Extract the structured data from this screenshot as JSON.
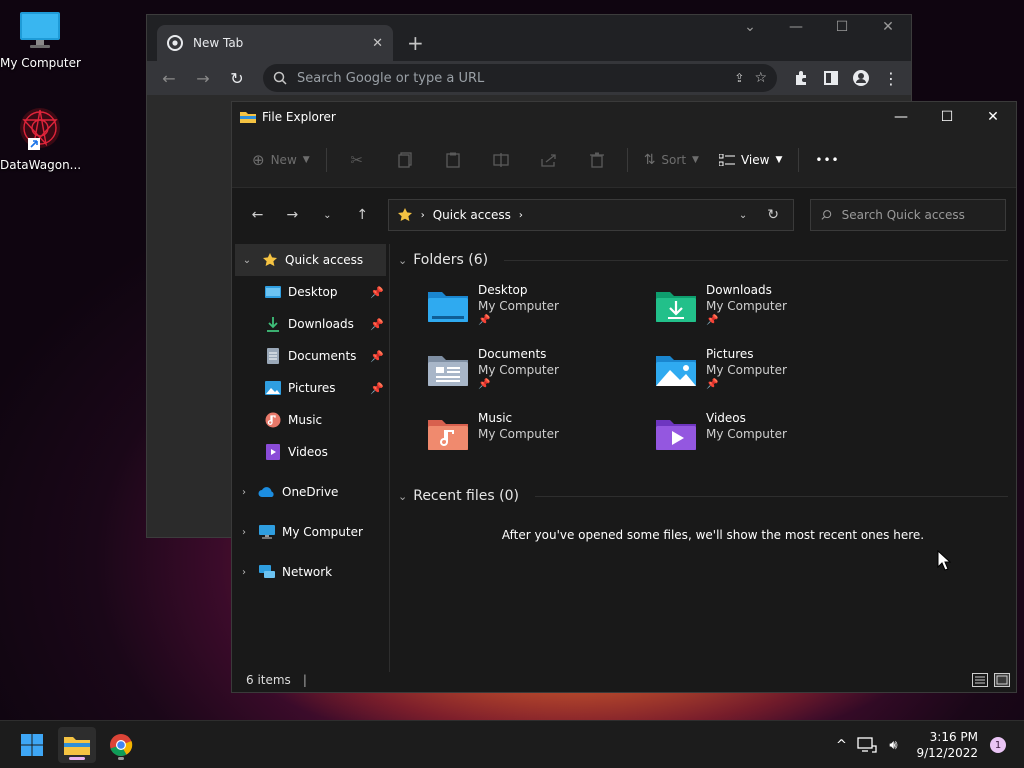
{
  "desktop": {
    "icons": [
      {
        "label": "My Computer"
      },
      {
        "label": "DataWagon..."
      }
    ]
  },
  "chrome": {
    "tab_title": "New Tab",
    "new_tab_glyph": "+",
    "omnibox_placeholder": "Search Google or type a URL"
  },
  "explorer": {
    "title": "File Explorer",
    "commands": {
      "new": "New",
      "sort": "Sort",
      "view": "View",
      "more": "•••"
    },
    "address": {
      "location": "Quick access"
    },
    "search_placeholder": "Search Quick access",
    "nav": {
      "quick_access": "Quick access",
      "pinned": [
        {
          "label": "Desktop",
          "pinned": true
        },
        {
          "label": "Downloads",
          "pinned": true
        },
        {
          "label": "Documents",
          "pinned": true
        },
        {
          "label": "Pictures",
          "pinned": true
        },
        {
          "label": "Music",
          "pinned": false
        },
        {
          "label": "Videos",
          "pinned": false
        }
      ],
      "onedrive": "OneDrive",
      "my_computer": "My Computer",
      "network": "Network"
    },
    "folders_header": "Folders (6)",
    "folders": [
      {
        "name": "Desktop",
        "location": "My Computer",
        "pinned": true,
        "icon": "desktop-folder-icon"
      },
      {
        "name": "Downloads",
        "location": "My Computer",
        "pinned": true,
        "icon": "downloads-folder-icon"
      },
      {
        "name": "Documents",
        "location": "My Computer",
        "pinned": true,
        "icon": "documents-folder-icon"
      },
      {
        "name": "Pictures",
        "location": "My Computer",
        "pinned": true,
        "icon": "pictures-folder-icon"
      },
      {
        "name": "Music",
        "location": "My Computer",
        "pinned": false,
        "icon": "music-folder-icon"
      },
      {
        "name": "Videos",
        "location": "My Computer",
        "pinned": false,
        "icon": "videos-folder-icon"
      }
    ],
    "recent_header": "Recent files (0)",
    "recent_empty": "After you've opened some files, we'll show the most recent ones here.",
    "status": {
      "items": "6 items",
      "separator": "|"
    }
  },
  "taskbar": {
    "time": "3:16 PM",
    "date": "9/12/2022",
    "notification_count": "1"
  },
  "colors": {
    "accent": "#0078d4",
    "folder_yellow": "#f5c342"
  }
}
